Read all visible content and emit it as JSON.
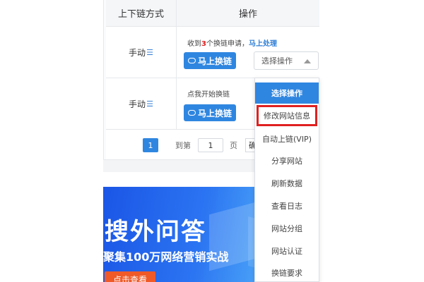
{
  "table": {
    "headers": [
      "上下链方式",
      "操作"
    ],
    "rows": [
      {
        "method": "手动",
        "method_icon": "sliders-icon",
        "notice_prefix": "收到",
        "notice_count": "3",
        "notice_suffix": "个换链申请，",
        "notice_link": "马上处理",
        "button": "马上换链",
        "select_value": "选择操作"
      },
      {
        "method": "手动",
        "method_icon": "sliders-icon",
        "notice": "点我开始换链",
        "button": "马上换链"
      }
    ]
  },
  "pagination": {
    "current_page": "1",
    "goto_prefix": "到第",
    "goto_value": "1",
    "goto_suffix": "页",
    "confirm_partial": "确"
  },
  "banner": {
    "title": "搜外问答",
    "subtitle": "聚集100万网络营销实战",
    "cta": "点击查看"
  },
  "menu": {
    "items": [
      "选择操作",
      "修改网站信息",
      "自动上链(VIP)",
      "分享网站",
      "刷新数据",
      "查看日志",
      "网站分组",
      "网站认证",
      "换链要求"
    ],
    "selected_index": 0,
    "highlighted_index": 1
  },
  "colors": {
    "primary": "#2f86e0",
    "alert_red": "#e02020",
    "link": "#2f7fd6"
  }
}
